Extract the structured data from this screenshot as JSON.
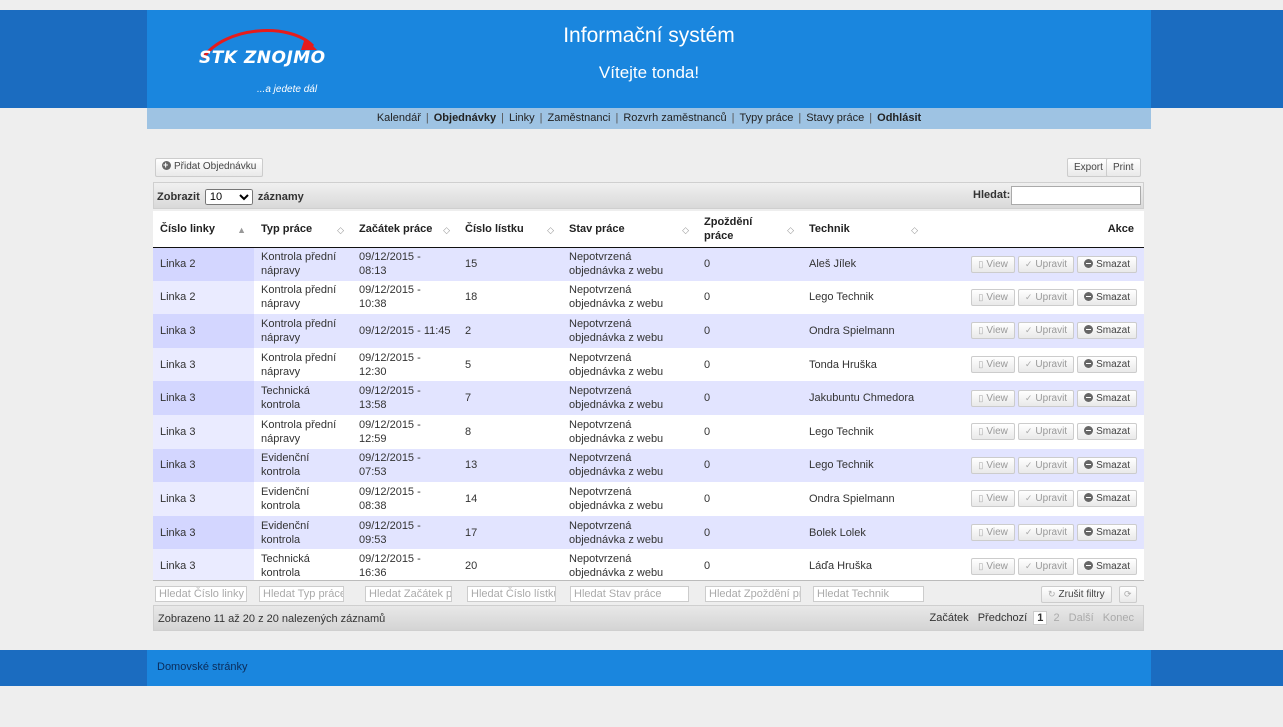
{
  "header": {
    "logo_text_1": "STK",
    "logo_text_2": "ZNOJMO",
    "logo_tagline": "...a jedete dál",
    "title": "Informační systém",
    "welcome": "Vítejte tonda!"
  },
  "nav": {
    "items": [
      {
        "label": "Kalendář",
        "bold": false
      },
      {
        "label": "Objednávky",
        "bold": true
      },
      {
        "label": "Linky",
        "bold": false
      },
      {
        "label": "Zaměstnanci",
        "bold": false
      },
      {
        "label": "Rozvrh zaměstnanců",
        "bold": false
      },
      {
        "label": "Typy práce",
        "bold": false
      },
      {
        "label": "Stavy práce",
        "bold": false
      },
      {
        "label": "Odhlásit",
        "bold": true
      }
    ]
  },
  "toolbar": {
    "add_label": "Přidat Objednávku",
    "export_label": "Export",
    "print_label": "Print",
    "show_prefix": "Zobrazit",
    "page_length": "10",
    "show_suffix": "záznamy",
    "search_label": "Hledat:"
  },
  "table": {
    "columns": [
      "Číslo linky",
      "Typ práce",
      "Začátek práce",
      "Číslo lístku",
      "Stav práce",
      "Zpoždění práce",
      "Technik",
      "Akce"
    ],
    "rows": [
      [
        "Linka 2",
        "Kontrola přední nápravy",
        "09/12/2015 - 08:13",
        "15",
        "Nepotvrzená objednávka z webu",
        "0",
        "Aleš Jílek"
      ],
      [
        "Linka 2",
        "Kontrola přední nápravy",
        "09/12/2015 - 10:38",
        "18",
        "Nepotvrzená objednávka z webu",
        "0",
        "Lego Technik"
      ],
      [
        "Linka 3",
        "Kontrola přední nápravy",
        "09/12/2015 - 11:45",
        "2",
        "Nepotvrzená objednávka z webu",
        "0",
        "Ondra Spielmann"
      ],
      [
        "Linka 3",
        "Kontrola přední nápravy",
        "09/12/2015 - 12:30",
        "5",
        "Nepotvrzená objednávka z webu",
        "0",
        "Tonda Hruška"
      ],
      [
        "Linka 3",
        "Technická kontrola",
        "09/12/2015 - 13:58",
        "7",
        "Nepotvrzená objednávka z webu",
        "0",
        "Jakubuntu Chmedora"
      ],
      [
        "Linka 3",
        "Kontrola přední nápravy",
        "09/12/2015 - 12:59",
        "8",
        "Nepotvrzená objednávka z webu",
        "0",
        "Lego Technik"
      ],
      [
        "Linka 3",
        "Evidenční kontrola",
        "09/12/2015 - 07:53",
        "13",
        "Nepotvrzená objednávka z webu",
        "0",
        "Lego Technik"
      ],
      [
        "Linka 3",
        "Evidenční kontrola",
        "09/12/2015 - 08:38",
        "14",
        "Nepotvrzená objednávka z webu",
        "0",
        "Ondra Spielmann"
      ],
      [
        "Linka 3",
        "Evidenční kontrola",
        "09/12/2015 - 09:53",
        "17",
        "Nepotvrzená objednávka z webu",
        "0",
        "Bolek Lolek"
      ],
      [
        "Linka 3",
        "Technická kontrola",
        "09/12/2015 - 16:36",
        "20",
        "Nepotvrzená objednávka z webu",
        "0",
        "Láďa Hruška"
      ]
    ],
    "action_labels": {
      "view": "View",
      "edit": "Upravit",
      "delete": "Smazat"
    }
  },
  "filters": {
    "placeholders": [
      "Hledat Číslo linky",
      "Hledat Typ práce",
      "Hledat Začátek práce",
      "Hledat Číslo lístku",
      "Hledat Stav práce",
      "Hledat Zpoždění práce",
      "Hledat Technik"
    ],
    "clear_label": "Zrušit filtry"
  },
  "info": {
    "text": "Zobrazeno 11 až 20 z 20 nalezených záznamů"
  },
  "pager": {
    "first": "Začátek",
    "prev": "Předchozí",
    "page1": "1",
    "page2": "2",
    "next": "Další",
    "last": "Konec"
  },
  "footer": {
    "link": "Domovské stránky"
  },
  "colors": {
    "header_blue": "#1a86de",
    "header_dark": "#1b6cc0",
    "nav_bg": "#9ec3e3",
    "row_odd": "#e2e4ff",
    "logo_red": "#e61b1b"
  }
}
